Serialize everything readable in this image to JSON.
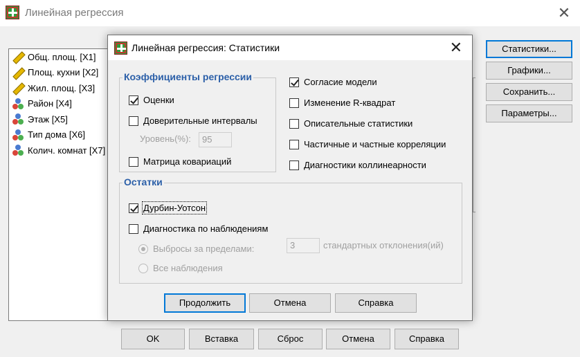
{
  "window": {
    "title": "Линейная регрессия",
    "close_glyph": "✕"
  },
  "variables": [
    {
      "label": "Общ. площ. [X1]",
      "icon": "scale-ruler-icon"
    },
    {
      "label": "Площ. кухни [X2]",
      "icon": "scale-ruler-icon"
    },
    {
      "label": "Жил. площ. [X3]",
      "icon": "scale-ruler-icon"
    },
    {
      "label": "Район [X4]",
      "icon": "nominal-icon"
    },
    {
      "label": "Этаж [X5]",
      "icon": "nominal-icon"
    },
    {
      "label": "Тип дома [X6]",
      "icon": "nominal-icon"
    },
    {
      "label": "Колич. комнат [X7]",
      "icon": "nominal-icon"
    }
  ],
  "side_buttons": {
    "statistics": "Статистики...",
    "plots": "Графики...",
    "save": "Сохранить...",
    "options": "Параметры..."
  },
  "bottom_buttons": {
    "ok": "OK",
    "paste": "Вставка",
    "reset": "Сброс",
    "cancel": "Отмена",
    "help": "Справка"
  },
  "dialog": {
    "title": "Линейная регрессия: Статистики",
    "close_glyph": "✕",
    "coefficients": {
      "legend": "Коэффициенты регрессии",
      "estimates": {
        "label": "Оценки",
        "checked": true
      },
      "confidence_intervals": {
        "label": "Доверительные интервалы",
        "checked": false
      },
      "level_label": "Уровень(%):",
      "level_value": "95",
      "covariance_matrix": {
        "label": "Матрица ковариаций",
        "checked": false
      }
    },
    "right_options": {
      "model_fit": {
        "label": "Согласие модели",
        "checked": true
      },
      "r_squared_change": {
        "label": "Изменение R-квадрат",
        "checked": false
      },
      "descriptives": {
        "label": "Описательные статистики",
        "checked": false
      },
      "part_partial": {
        "label": "Частичные и частные корреляции",
        "checked": false
      },
      "collinearity": {
        "label": "Диагностики коллинеарности",
        "checked": false
      }
    },
    "residuals": {
      "legend": "Остатки",
      "durbin_watson": {
        "label": "Дурбин-Уотсон",
        "checked": true
      },
      "casewise": {
        "label": "Диагностика по наблюдениям",
        "checked": false
      },
      "outliers_label": "Выбросы за пределами:",
      "outliers_value": "3",
      "sd_label": "стандартных отклонения(ий)",
      "all_cases_label": "Все наблюдения"
    },
    "buttons": {
      "continue": "Продолжить",
      "cancel": "Отмена",
      "help": "Справка"
    }
  }
}
